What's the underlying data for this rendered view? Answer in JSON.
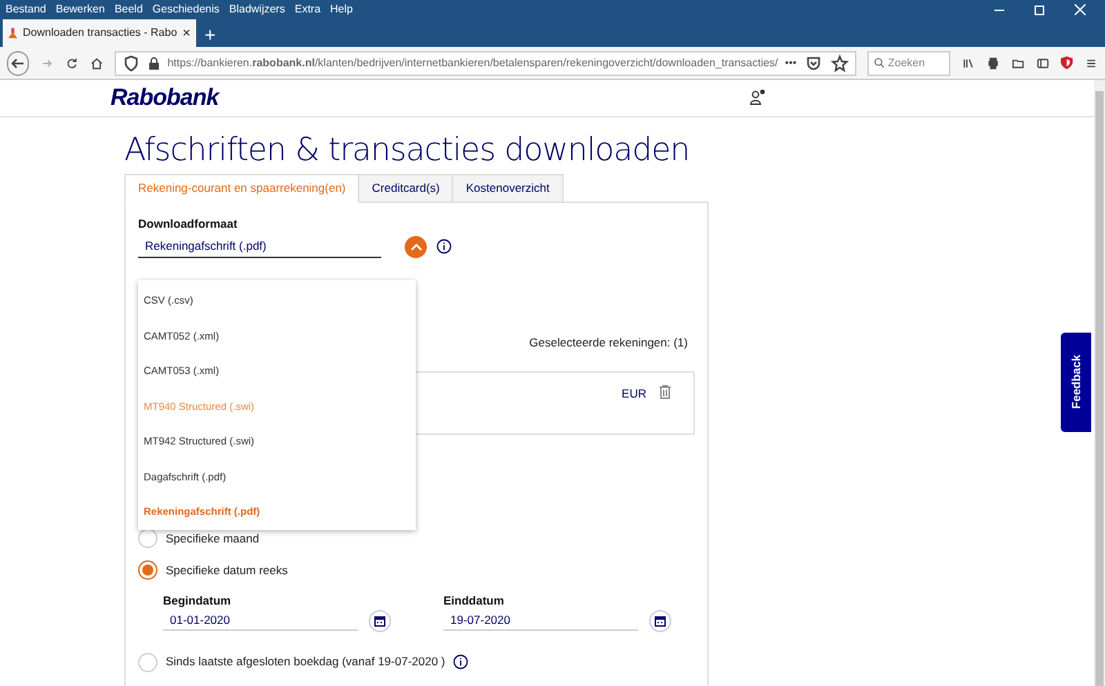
{
  "browser": {
    "menu": [
      "Bestand",
      "Bewerken",
      "Beeld",
      "Geschiedenis",
      "Bladwijzers",
      "Extra",
      "Help"
    ],
    "tab": {
      "title": "Downloaden transacties - Rabo",
      "close": "×"
    },
    "new_tab": "+",
    "url": "https://bankieren.**rabobank.nl**/klanten/bedrijven/internetbankieren/betalensparen/rekeningoverzicht/downloaden_transacties/",
    "more": "•••",
    "search": {
      "placeholder": "Zoeken"
    }
  },
  "page": {
    "logo": "Rabobank",
    "title": "Afschriften & transacties downloaden",
    "tabs": [
      {
        "label": "Rekening-courant en spaarrekening(en)",
        "selected": true
      },
      {
        "label": "Creditcard(s)",
        "selected": false
      },
      {
        "label": "Kostenoverzicht",
        "selected": false
      }
    ],
    "format": {
      "label": "Downloadformaat",
      "value": "Rekeningafschrift (.pdf)",
      "expanded": true
    },
    "options": [
      {
        "label": "CSV (.csv)",
        "selected": false,
        "highlighted": false
      },
      {
        "label": "CAMT052 (.xml)",
        "selected": false,
        "highlighted": false
      },
      {
        "label": "CAMT053 (.xml)",
        "selected": false,
        "highlighted": false
      },
      {
        "label": "MT940 Structured (.swi)",
        "selected": false,
        "highlighted": true
      },
      {
        "label": "MT942 Structured (.swi)",
        "selected": false,
        "highlighted": false
      },
      {
        "label": "Dagafschrift (.pdf)",
        "selected": false,
        "highlighted": false
      },
      {
        "label": "Rekeningafschrift (.pdf)",
        "selected": true,
        "highlighted": false
      }
    ],
    "selected_accounts": "Geselecteerde rekeningen: (1)",
    "account": {
      "currency": "EUR"
    },
    "periods": [
      {
        "label": "Specifieke maand",
        "selected": false
      },
      {
        "label": "Specifieke datum reeks",
        "selected": true
      }
    ],
    "dates": [
      {
        "label": "Begindatum",
        "value": "01-01-2020"
      },
      {
        "label": "Einddatum",
        "value": "19-07-2020"
      }
    ],
    "last_period": {
      "label": "Sinds laatste afgesloten boekdag (vanaf 19-07-2020 )",
      "selected": false
    },
    "feedback": "Feedback"
  }
}
